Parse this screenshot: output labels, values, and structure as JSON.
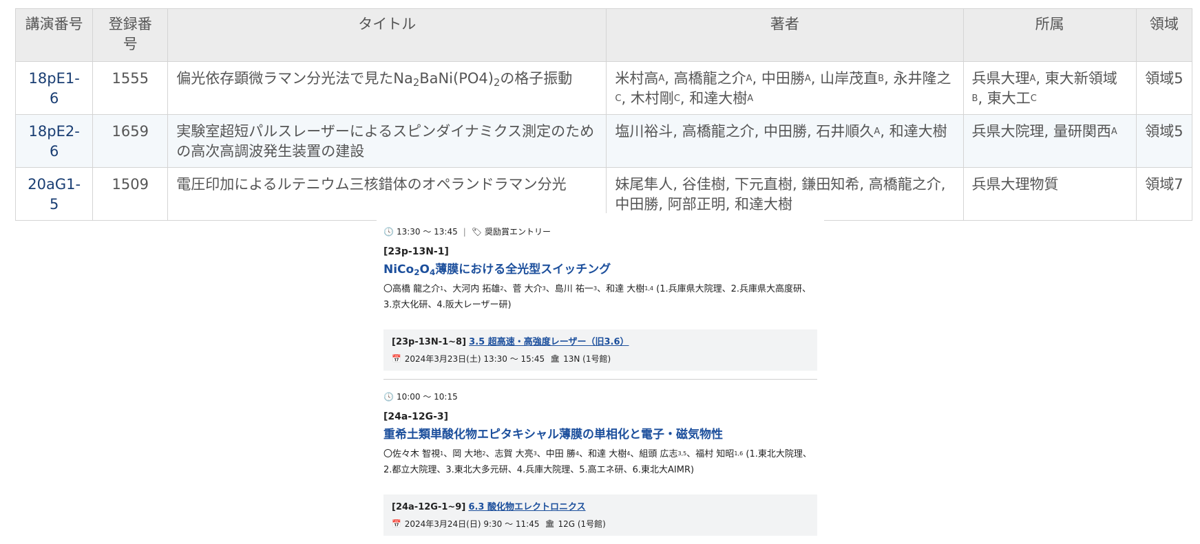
{
  "table": {
    "headers": [
      "講演番号",
      "登録番号",
      "タイトル",
      "著者",
      "所属",
      "領域"
    ],
    "rows": [
      {
        "id": "18pE1-6",
        "num": "1555",
        "title_parts": [
          "偏光依存顕微ラマン分光法で見たNa",
          "2",
          "BaNi(PO4)",
          "2",
          "の格子振動"
        ],
        "authors_parts": [
          "米村高",
          "A",
          ", 高橋龍之介",
          "A",
          ", 中田勝",
          "A",
          ", 山岸茂直",
          "B",
          ", 永井隆之",
          "C",
          ", 木村剛",
          "C",
          ", 和達大樹",
          "A"
        ],
        "affil_parts": [
          "兵県大理",
          "A",
          ", 東大新領域",
          "B",
          ", 東大工",
          "C"
        ],
        "area": "領域5"
      },
      {
        "id": "18pE2-6",
        "num": "1659",
        "title": "実験室超短パルスレーザーによるスピンダイナミクス測定のための高次高調波発生装置の建設",
        "authors_parts": [
          "塩川裕斗, 高橋龍之介, 中田勝, 石井順久",
          "A",
          ", 和達大樹"
        ],
        "affil_parts": [
          "兵県大院理, 量研関西",
          "A"
        ],
        "area": "領域5"
      },
      {
        "id": "20aG1-5",
        "num": "1509",
        "title": "電圧印加によるルテニウム三核錯体のオペランドラマン分光",
        "authors": "妹尾隼人, 谷佳樹, 下元直樹, 鎌田知希, 高橋龍之介, 中田勝, 阿部正明, 和達大樹",
        "affil": "兵県大理物質",
        "area": "領域7"
      }
    ]
  },
  "program": {
    "entries": [
      {
        "time": "13:30 〜 13:45",
        "tag": "奨励賞エントリー",
        "code": "[23p-13N-1]",
        "title_parts": [
          "NiCo",
          "2",
          "O",
          "4",
          "薄膜における全光型スイッチング"
        ],
        "authors_parts": [
          "〇高橋 龍之介",
          "1",
          "、大河内 拓雄",
          "2",
          "、菅 大介",
          "3",
          "、島川 祐一",
          "3",
          "、和達 大樹",
          "1,4",
          " (1.兵庫県大院理、2.兵庫県大高度研、3.京大化研、4.阪大レーザー研)"
        ],
        "session_code": "[23p-13N-1~8]",
        "session_link": "3.5 超高速・高強度レーザー（旧3.6）",
        "session_date": "2024年3月23日(土) 13:30 〜 15:45",
        "session_room": "13N (1号館)"
      },
      {
        "time": "10:00 〜 10:15",
        "code": "[24a-12G-3]",
        "title": "重希土類単酸化物エピタキシャル薄膜の単相化と電子・磁気物性",
        "authors_parts": [
          "〇佐々木 智視",
          "1",
          "、岡 大地",
          "2",
          "、志賀 大亮",
          "3",
          "、中田 勝",
          "4",
          "、和達 大樹",
          "4",
          "、組頭 広志",
          "3,5",
          "、福村 知昭",
          "1,6",
          " (1.東北大院理、2.都立大院理、3.東北大多元研、4.兵庫大院理、5.高エネ研、6.東北大AIMR)"
        ],
        "session_code": "[24a-12G-1~9]",
        "session_link": "6.3 酸化物エレクトロニクス",
        "session_date": "2024年3月24日(日) 9:30 〜 11:45",
        "session_room": "12G (1号館)"
      }
    ]
  },
  "icons": {
    "clock": "clock-icon",
    "tag": "tag-icon",
    "calendar": "calendar-icon",
    "building": "building-icon"
  },
  "colors": {
    "link_dark": "#1a3e73",
    "title_blue": "#1c4f9c",
    "header_bg": "#ececec",
    "alt_row_bg": "#f4f8fb",
    "session_bg": "#f2f3f4"
  }
}
